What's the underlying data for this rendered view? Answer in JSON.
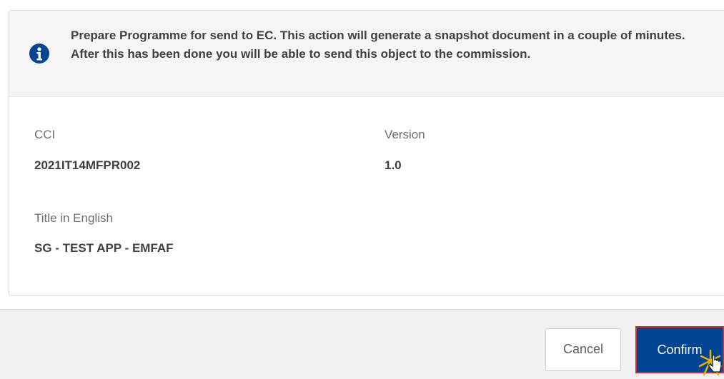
{
  "info": {
    "icon": "info-circle-icon",
    "message": "Prepare Programme for send to EC. This action will generate a snapshot document in a couple of minutes. After this has been done you will be able to send this object to the commission."
  },
  "fields": {
    "cci_label": "CCI",
    "cci_value": "2021IT14MFPR002",
    "version_label": "Version",
    "version_value": "1.0",
    "title_label": "Title in English",
    "title_value": "SG - TEST APP - EMFAF"
  },
  "footer": {
    "cancel_label": "Cancel",
    "confirm_label": "Confirm"
  },
  "colors": {
    "primary": "#004494",
    "highlight": "#d12b2b"
  }
}
